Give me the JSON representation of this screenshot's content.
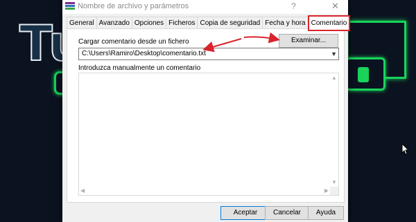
{
  "window": {
    "title": "Nombre de archivo y parámetros",
    "help_label": "?",
    "close_label": "✕"
  },
  "tabs": [
    {
      "label": "General"
    },
    {
      "label": "Avanzado"
    },
    {
      "label": "Opciones"
    },
    {
      "label": "Ficheros"
    },
    {
      "label": "Copia de seguridad"
    },
    {
      "label": "Fecha y hora"
    },
    {
      "label": "Comentario",
      "active": true
    }
  ],
  "comment_tab": {
    "load_label": "Cargar comentario desde un fichero",
    "browse_button": "Examinar...",
    "path_value": "C:\\Users\\Ramiro\\Desktop\\comentario.txt",
    "manual_label": "Introduzca manualmente un comentario",
    "manual_value": ""
  },
  "buttons": {
    "ok": "Aceptar",
    "cancel": "Cancelar",
    "help": "Ayuda"
  },
  "background": {
    "logo_text": "Tu"
  },
  "colors": {
    "annotation": "#d9242b",
    "background": "#0c1320",
    "logo_green": "#19d35b"
  }
}
